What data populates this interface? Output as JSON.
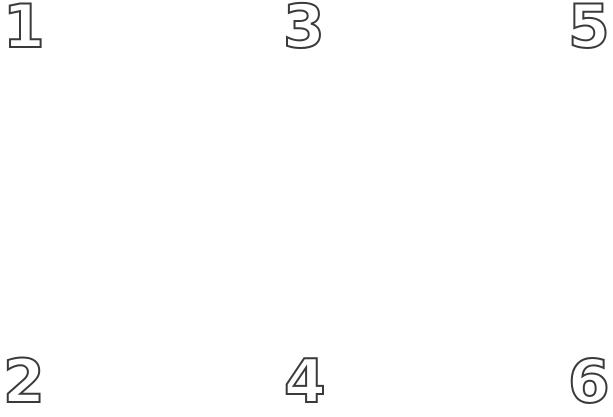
{
  "numbers": {
    "top_left": "1",
    "top_center": "3",
    "top_right": "5",
    "bottom_left": "2",
    "bottom_center": "4",
    "bottom_right": "6"
  },
  "colors": {
    "background": "#ffffff",
    "outline": "#3a3a3a",
    "fill": "#ffffff"
  }
}
